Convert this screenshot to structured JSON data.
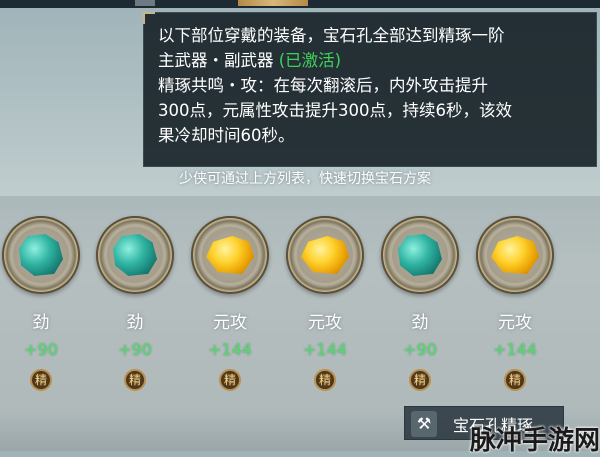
{
  "tooltip": {
    "line1": "以下部位穿戴的装备，宝石孔全部达到精琢一阶",
    "line2_parts": "主武器・副武器",
    "line2_status": "(已激活)",
    "line3": "精琢共鸣・攻：在每次翻滚后，内外攻击提升",
    "line4": "300点，元属性攻击提升300点，持续6秒，该效",
    "line5": "果冷却时间60秒。"
  },
  "hint": "少侠可通过上方列表，快速切换宝石方案",
  "slots": [
    {
      "name": "劲",
      "value": "+90",
      "gem": "green",
      "badge": "精"
    },
    {
      "name": "劲",
      "value": "+90",
      "gem": "green",
      "badge": "精"
    },
    {
      "name": "元攻",
      "value": "+144",
      "gem": "gold",
      "badge": "精"
    },
    {
      "name": "元攻",
      "value": "+144",
      "gem": "gold",
      "badge": "精"
    },
    {
      "name": "劲",
      "value": "+90",
      "gem": "green",
      "badge": "精"
    },
    {
      "name": "元攻",
      "value": "+144",
      "gem": "gold",
      "badge": "精"
    }
  ],
  "button": {
    "icon": "hammer-icon",
    "label": "宝石孔精琢"
  },
  "watermark": "脉冲手游网",
  "colors": {
    "active": "#3fd15c",
    "value": "#4fdc6a"
  }
}
